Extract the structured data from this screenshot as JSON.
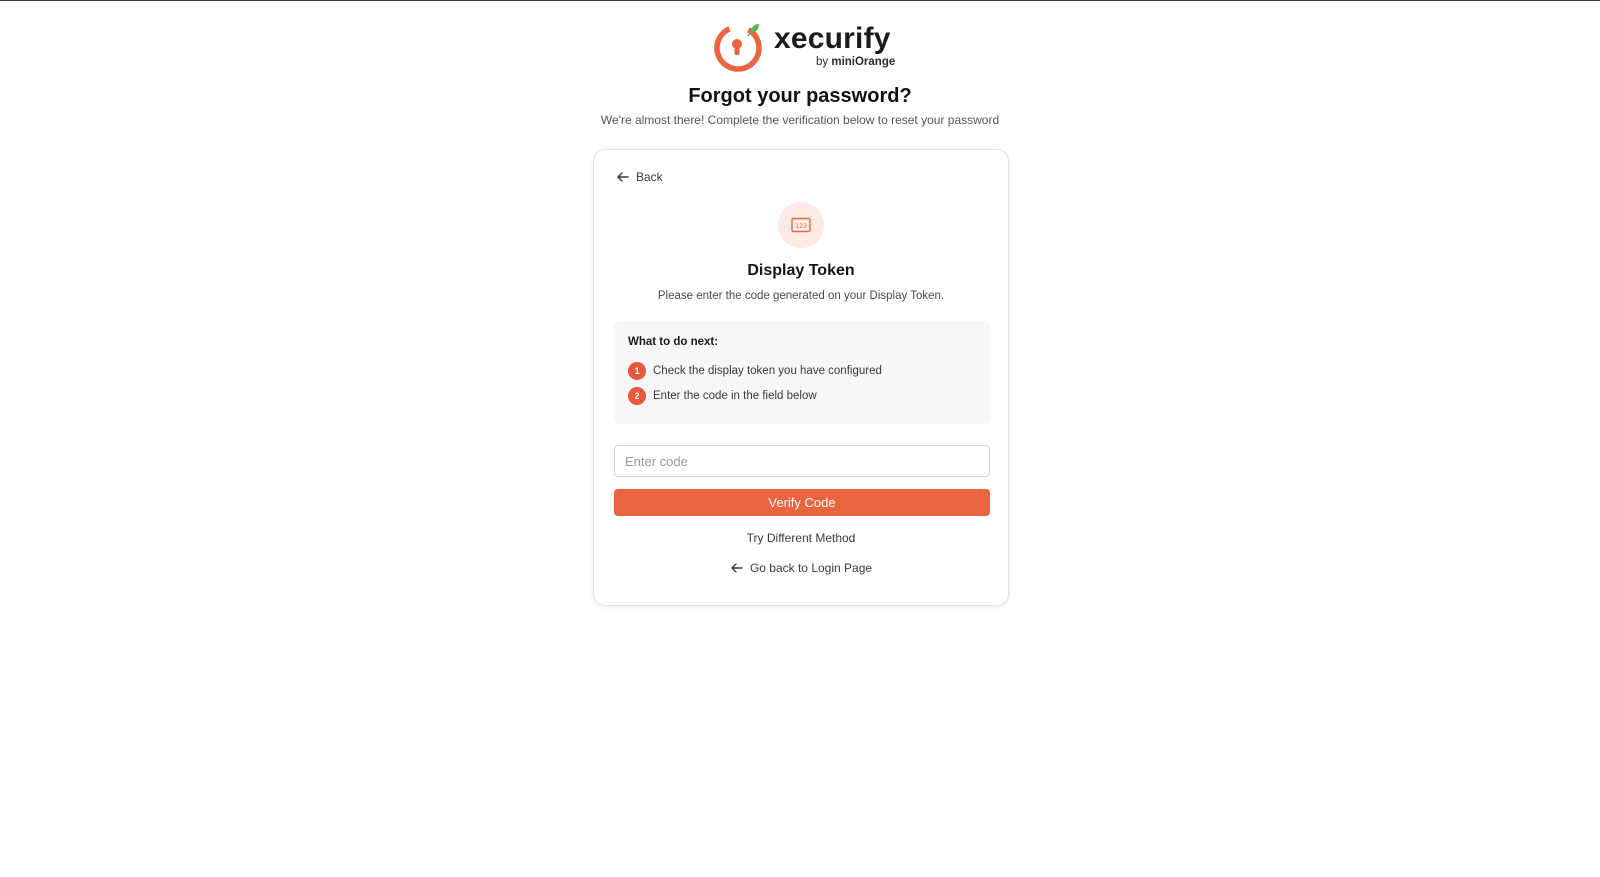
{
  "brand": {
    "name": "xecurify",
    "byline_prefix": "by ",
    "byline_company": "miniOrange",
    "accent_color": "#e9643f",
    "leaf_color": "#5fb04d"
  },
  "header": {
    "title": "Forgot your password?",
    "subtitle": "We're almost there! Complete the verification below to reset your password"
  },
  "card": {
    "back_label": "Back",
    "icon": "display-token-icon",
    "title": "Display Token",
    "description": "Please enter the code generated on your Display Token.",
    "steps": {
      "heading": "What to do next:",
      "items": [
        {
          "number": "1",
          "text": "Check the display token you have configured"
        },
        {
          "number": "2",
          "text": "Enter the code in the field below"
        }
      ]
    },
    "code_input": {
      "placeholder": "Enter code",
      "value": ""
    },
    "verify_label": "Verify Code",
    "try_different_label": "Try Different Method",
    "go_back_label": "Go back to Login Page"
  }
}
